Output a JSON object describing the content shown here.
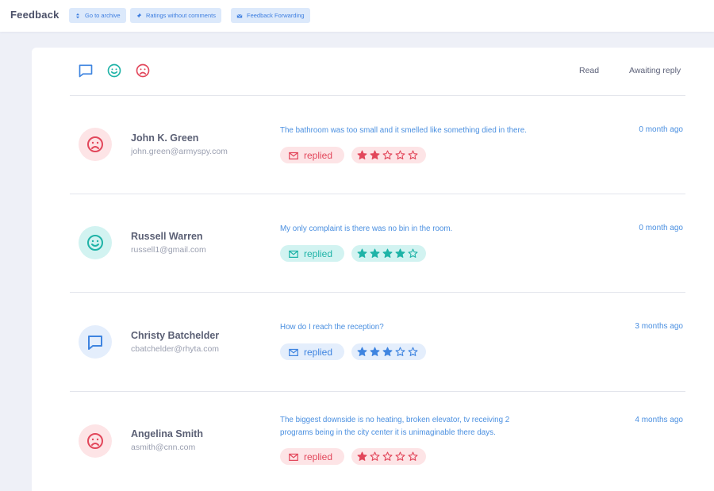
{
  "page_title": "Feedback",
  "top_buttons": [
    {
      "label": "Go to archive",
      "icon": "sort-arrows-icon"
    },
    {
      "label": "Ratings without comments",
      "icon": "pin-icon"
    },
    {
      "label": "Feedback Forwarding",
      "icon": "mail-tray-icon"
    }
  ],
  "filters": {
    "icons": [
      "chat-bubble-icon",
      "smile-icon",
      "frown-icon"
    ],
    "tabs": [
      "Read",
      "Awaiting reply"
    ]
  },
  "colors": {
    "negative": "#e2475b",
    "positive": "#1fb3a7",
    "neutral": "#3e84e0",
    "accent": "#4a8fe0"
  },
  "feedback": [
    {
      "name": "John K. Green",
      "email": "john.green@armyspy.com",
      "comment": "The bathroom was too small and it smelled like something died in there.",
      "time": "0 month ago",
      "status": "replied",
      "sentiment": "negative",
      "avatar_icon": "frown-icon",
      "rating": 2,
      "rating_max": 5
    },
    {
      "name": "Russell Warren",
      "email": "russell1@gmail.com",
      "comment": "My only complaint is there was no bin in the room.",
      "time": "0 month ago",
      "status": "replied",
      "sentiment": "positive",
      "avatar_icon": "smile-icon",
      "rating": 4,
      "rating_max": 5
    },
    {
      "name": "Christy Batchelder",
      "email": "cbatchelder@rhyta.com",
      "comment": "How do I reach the reception?",
      "time": "3 months ago",
      "status": "replied",
      "sentiment": "neutral",
      "avatar_icon": "chat-bubble-icon",
      "rating": 3,
      "rating_max": 5
    },
    {
      "name": "Angelina Smith",
      "email": "asmith@cnn.com",
      "comment": "The biggest downside is no heating, broken elevator, tv receiving 2 programs being in the city center it is unimaginable there days.",
      "time": "4 months ago",
      "status": "replied",
      "sentiment": "negative",
      "avatar_icon": "frown-icon",
      "rating": 1,
      "rating_max": 5
    }
  ]
}
